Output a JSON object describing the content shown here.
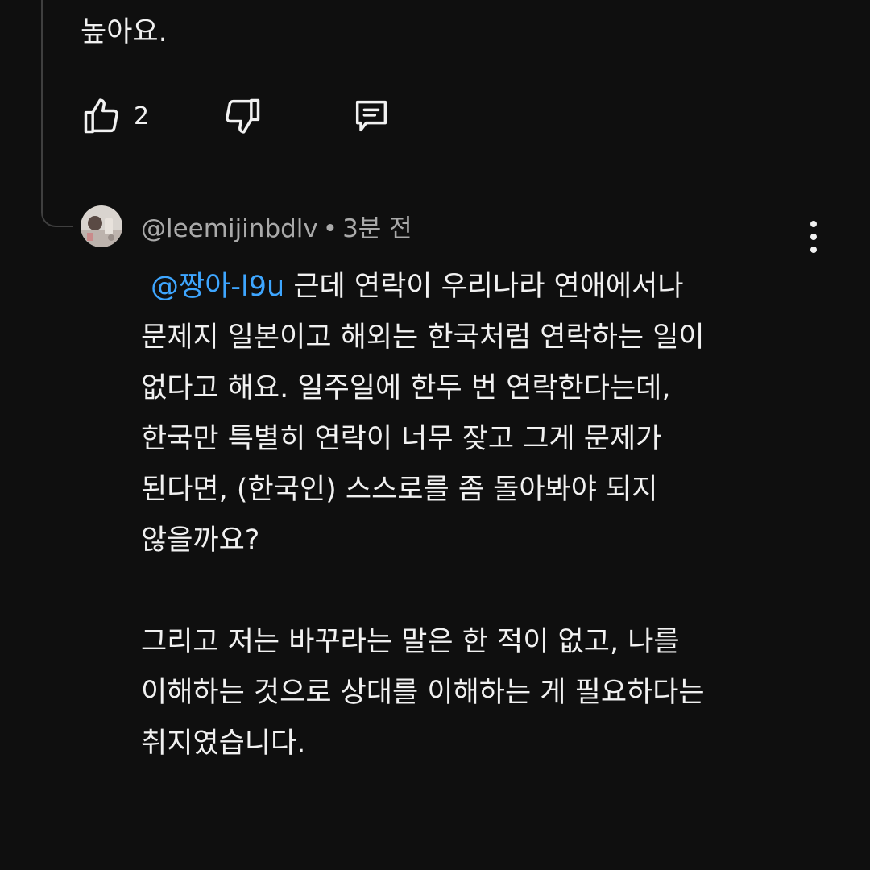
{
  "previous_reply": {
    "text_tail": "높아요.",
    "like_count": "2",
    "icons": {
      "like": "thumbs-up-icon",
      "dislike": "thumbs-down-icon",
      "reply": "comment-reply-icon"
    }
  },
  "reply": {
    "author_handle": "@leemijinbdlv",
    "separator": "•",
    "time_ago": "3분 전",
    "mention": "@짱아-l9u",
    "body_para1_line1_rest": " 근데 연락이 우리나라 연애에서나",
    "body_para1_rest": "문제지 일본이고 해외는 한국처럼 연락하는 일이\n없다고 해요. 일주일에 한두 번 연락한다는데,\n한국만 특별히 연락이 너무 잦고 그게 문제가\n된다면, (한국인) 스스로를 좀 돌아봐야 되지\n않을까요?\n\n그리고 저는 바꾸라는 말은 한 적이 없고, 나를\n이해하는 것으로 상대를 이해하는 게 필요하다는\n취지였습니다.",
    "menu_icon": "more-vertical-icon",
    "avatar_icon": "avatar"
  }
}
